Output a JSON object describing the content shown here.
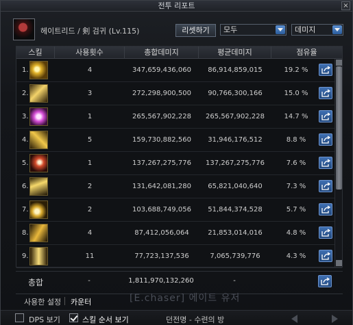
{
  "window": {
    "title": "전투 리포트",
    "close_label": "×"
  },
  "header": {
    "character": "헤이트리드 / 剣 검귀 (Lv.115)",
    "reset_label": "리셋하기",
    "filter_selected": "모두",
    "type_selected": "데미지"
  },
  "table": {
    "columns": [
      "스킬",
      "사용횟수",
      "총합데미지",
      "평균데미지",
      "점유율"
    ],
    "rows": [
      {
        "rank": "1.",
        "count": "4",
        "total": "347,659,436,060",
        "avg": "86,914,859,015",
        "share": "19.2 %"
      },
      {
        "rank": "2.",
        "count": "3",
        "total": "272,298,900,500",
        "avg": "90,766,300,166",
        "share": "15.0 %"
      },
      {
        "rank": "3.",
        "count": "1",
        "total": "265,567,902,228",
        "avg": "265,567,902,228",
        "share": "14.7 %"
      },
      {
        "rank": "4.",
        "count": "5",
        "total": "159,730,882,560",
        "avg": "31,946,176,512",
        "share": "8.8 %"
      },
      {
        "rank": "5.",
        "count": "1",
        "total": "137,267,275,776",
        "avg": "137,267,275,776",
        "share": "7.6 %"
      },
      {
        "rank": "6.",
        "count": "2",
        "total": "131,642,081,280",
        "avg": "65,821,040,640",
        "share": "7.3 %"
      },
      {
        "rank": "7.",
        "count": "2",
        "total": "103,688,749,056",
        "avg": "51,844,374,528",
        "share": "5.7 %"
      },
      {
        "rank": "8.",
        "count": "4",
        "total": "87,412,056,064",
        "avg": "21,853,014,016",
        "share": "4.8 %"
      },
      {
        "rank": "9.",
        "count": "11",
        "total": "77,723,137,536",
        "avg": "7,065,739,776",
        "share": "4.3 %"
      }
    ]
  },
  "total": {
    "label": "총합",
    "count": "-",
    "total": "1,811,970,132,260",
    "avg": "-"
  },
  "tabs": {
    "settings": "사용한 설정",
    "counter": "카운터"
  },
  "watermark": "[E.chaser] 에이트 유저",
  "footer": {
    "dps_label": "DPS 보기",
    "order_label": "스킬 순서 보기",
    "dungeon": "던전명 - 수련의 방"
  },
  "colors": {
    "accent": "#2f5fa0",
    "panel": "#14161a"
  }
}
